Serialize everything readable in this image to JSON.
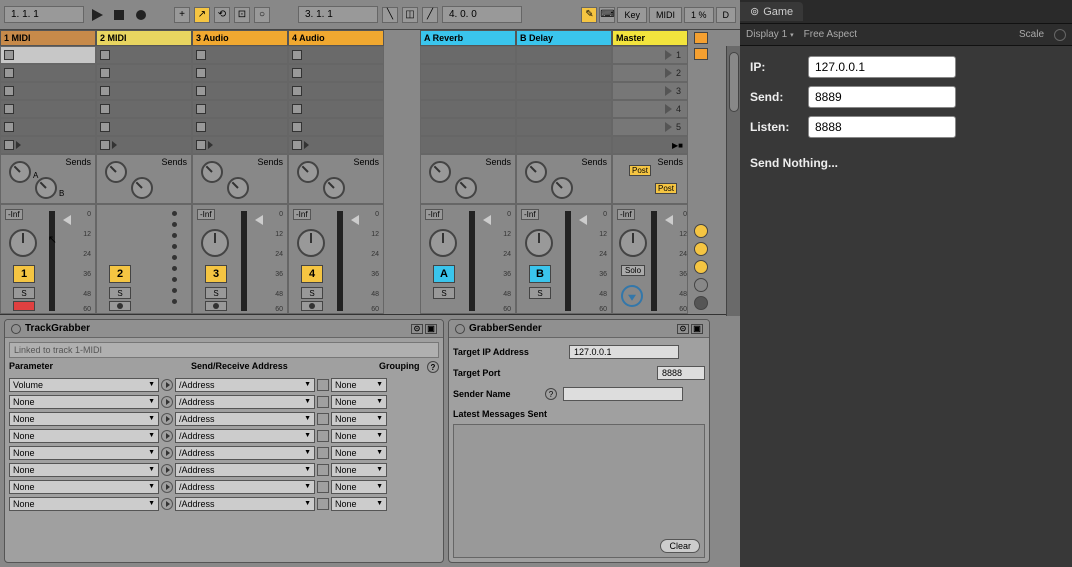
{
  "topbar": {
    "position_display": "1.  1.  1",
    "loop_position": "3.  1.  1",
    "loop_length": "4.  0.  0",
    "key_label": "Key",
    "midi_label": "MIDI",
    "pct_label": "1 %",
    "d_label": "D"
  },
  "tracks": [
    {
      "name": "1 MIDI",
      "color": "#c78a4a",
      "num": "1",
      "num_color": "#f5c542"
    },
    {
      "name": "2 MIDI",
      "color": "#e8d560",
      "num": "2",
      "num_color": "#f5c542"
    },
    {
      "name": "3 Audio",
      "color": "#f0a830",
      "num": "3",
      "num_color": "#f5c542"
    },
    {
      "name": "4 Audio",
      "color": "#f0a830",
      "num": "4",
      "num_color": "#f5c542"
    }
  ],
  "returns": [
    {
      "name": "A Reverb",
      "color": "#3ac5ed",
      "num": "A"
    },
    {
      "name": "B Delay",
      "color": "#3ac5ed",
      "num": "B"
    }
  ],
  "master": {
    "name": "Master",
    "color": "#f2e43d",
    "solo_label": "Solo"
  },
  "scenes": [
    "1",
    "2",
    "3",
    "4",
    "5"
  ],
  "sends_label": "Sends",
  "sends_a": "A",
  "sends_b": "B",
  "post_label": "Post",
  "inf_label": "-Inf",
  "solo_label": "S",
  "scale": {
    "v0": "0",
    "v12": "12",
    "v24": "24",
    "v36": "36",
    "v48": "48",
    "v60": "60"
  },
  "trackgrabber": {
    "title": "TrackGrabber",
    "linked": "Linked to track 1-MIDI",
    "head_param": "Parameter",
    "head_addr": "Send/Receive Address",
    "head_group": "Grouping",
    "help": "?",
    "rows": [
      {
        "param": "Volume",
        "addr": "/Address",
        "group": "None"
      },
      {
        "param": "None",
        "addr": "/Address",
        "group": "None"
      },
      {
        "param": "None",
        "addr": "/Address",
        "group": "None"
      },
      {
        "param": "None",
        "addr": "/Address",
        "group": "None"
      },
      {
        "param": "None",
        "addr": "/Address",
        "group": "None"
      },
      {
        "param": "None",
        "addr": "/Address",
        "group": "None"
      },
      {
        "param": "None",
        "addr": "/Address",
        "group": "None"
      },
      {
        "param": "None",
        "addr": "/Address",
        "group": "None"
      }
    ]
  },
  "grabbersender": {
    "title": "GrabberSender",
    "target_ip_label": "Target IP Address",
    "target_ip": "127.0.0.1",
    "target_port_label": "Target Port",
    "target_port": "8888",
    "sender_name_label": "Sender Name",
    "sender_name": "",
    "latest_label": "Latest Messages Sent",
    "clear_label": "Clear",
    "help": "?"
  },
  "unity": {
    "tab": "Game",
    "display": "Display 1",
    "aspect": "Free Aspect",
    "scale_label": "Scale",
    "ip_label": "IP:",
    "ip": "127.0.0.1",
    "send_label": "Send:",
    "send": "8889",
    "listen_label": "Listen:",
    "listen": "8888",
    "status": "Send Nothing..."
  }
}
